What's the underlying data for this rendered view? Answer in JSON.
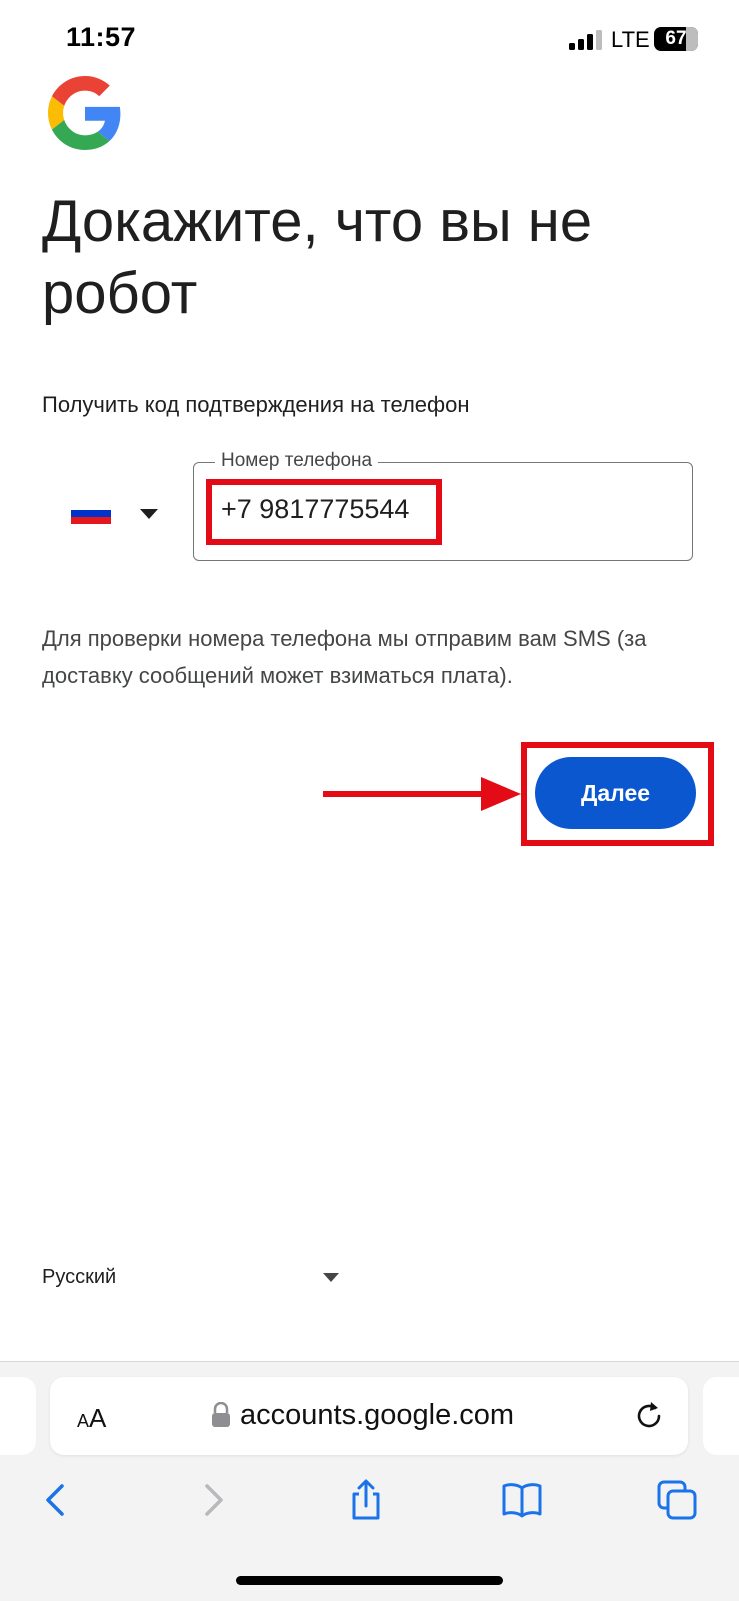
{
  "status_bar": {
    "time": "11:57",
    "network": "LTE",
    "battery": "67"
  },
  "page": {
    "heading": "Докажите, что вы не робот",
    "subtitle": "Получить код подтверждения на телефон",
    "phone_field": {
      "label": "Номер телефона",
      "value": "+7 9817775544"
    },
    "info_text": "Для проверки номера телефона мы отправим вам SMS (за доставку сообщений может взиматься плата).",
    "next_button": "Далее",
    "language": "Русский"
  },
  "browser": {
    "text_size_label_small": "A",
    "text_size_label_large": "A",
    "url": "accounts.google.com"
  },
  "colors": {
    "accent": "#0b57d0",
    "annotation_red": "#e20b16"
  }
}
